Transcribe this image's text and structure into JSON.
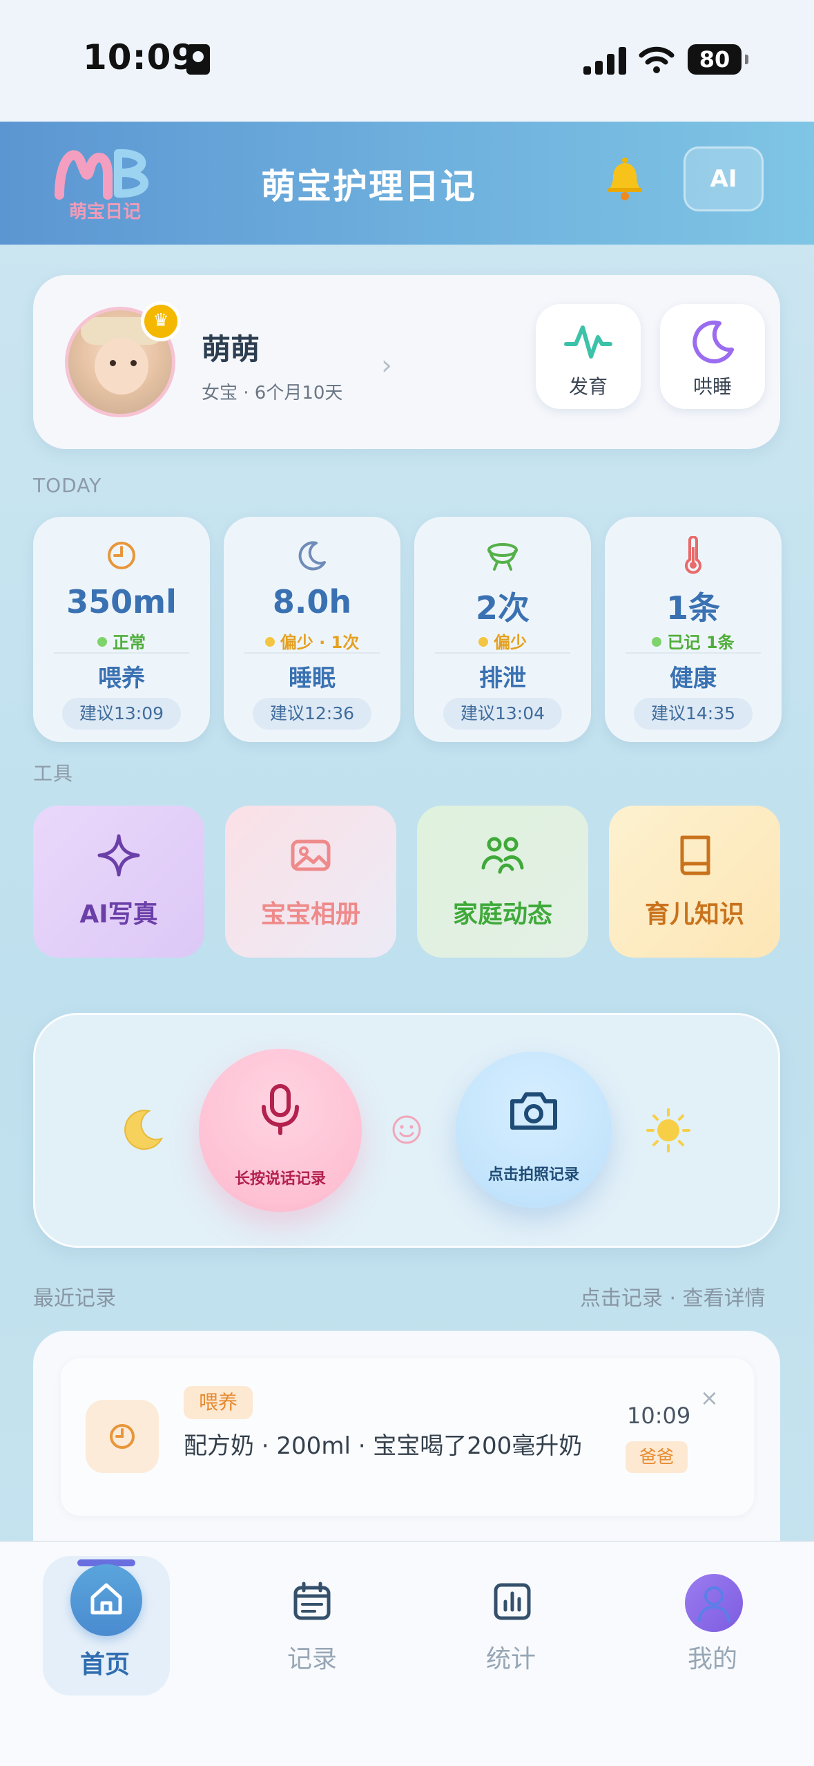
{
  "status_bar": {
    "time": "10:09",
    "battery": "80"
  },
  "header": {
    "logo_text": "萌宝日记",
    "title": "萌宝护理日记",
    "ai_label": "AI"
  },
  "profile": {
    "name": "萌萌",
    "info": "女宝 · 6个月10天",
    "quick": [
      {
        "label": "发育"
      },
      {
        "label": "哄睡"
      }
    ]
  },
  "today_label": "TODAY",
  "stats": [
    {
      "value": "350ml",
      "status": "正常",
      "status_color": "#4fae3b",
      "dot_color": "#7ed36b",
      "name": "喂养",
      "suggest": "建议13:09"
    },
    {
      "value": "8.0h",
      "status": "偏少 · 1次",
      "status_color": "#e5a020",
      "dot_color": "#f4c542",
      "name": "睡眠",
      "suggest": "建议12:36"
    },
    {
      "value": "2次",
      "status": "偏少",
      "status_color": "#e5a020",
      "dot_color": "#f4c542",
      "name": "排泄",
      "suggest": "建议13:04"
    },
    {
      "value": "1条",
      "status": "已记 1条",
      "status_color": "#4fae3b",
      "dot_color": "#7ed36b",
      "name": "健康",
      "suggest": "建议14:35"
    }
  ],
  "tools_label": "工具",
  "tools": [
    {
      "label": "AI写真",
      "color": "#6b3fa8"
    },
    {
      "label": "宝宝相册",
      "color": "#ef8a8a"
    },
    {
      "label": "家庭动态",
      "color": "#3fa93a"
    },
    {
      "label": "育儿知识",
      "color": "#c9721c"
    }
  ],
  "record": {
    "voice_label": "长按说话记录",
    "photo_label": "点击拍照记录"
  },
  "recent": {
    "title": "最近记录",
    "hint": "点击记录 · 查看详情",
    "items": [
      {
        "tag": "喂养",
        "text": "配方奶 · 200ml · 宝宝喝了200毫升奶",
        "time": "10:09",
        "user": "爸爸",
        "close": "×"
      }
    ]
  },
  "tabs": [
    {
      "label": "首页"
    },
    {
      "label": "记录"
    },
    {
      "label": "统计"
    },
    {
      "label": "我的"
    }
  ],
  "colors": {
    "accent": "#3a71b2",
    "header_start": "#5c96d2",
    "header_end": "#7fc5e4"
  }
}
